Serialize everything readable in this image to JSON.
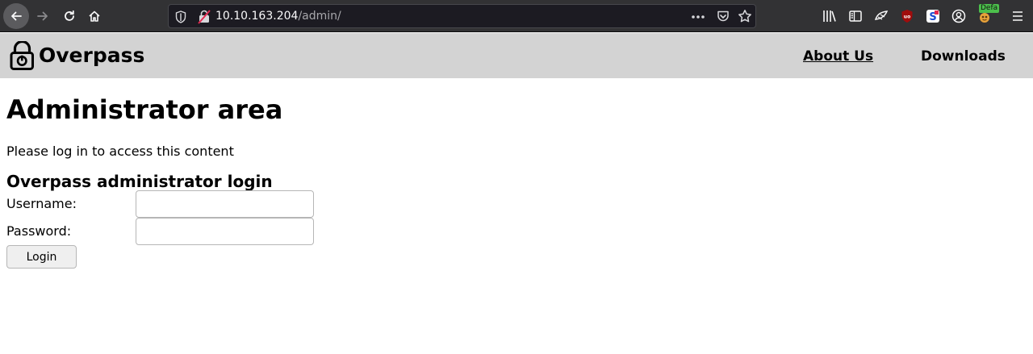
{
  "browser": {
    "url_host": "10.10.163.204",
    "url_path": "/admin/",
    "container_badge": "Defa",
    "accent_color": "#323234"
  },
  "header": {
    "brand": "Overpass",
    "nav": [
      {
        "label": "About Us"
      },
      {
        "label": "Downloads"
      }
    ],
    "background_color": "#d3d3d3"
  },
  "main": {
    "title": "Administrator area",
    "intro": "Please log in to access this content",
    "login": {
      "heading": "Overpass administrator login",
      "username_label": "Username:",
      "username_value": "",
      "password_label": "Password:",
      "password_value": "",
      "submit_label": "Login"
    }
  }
}
